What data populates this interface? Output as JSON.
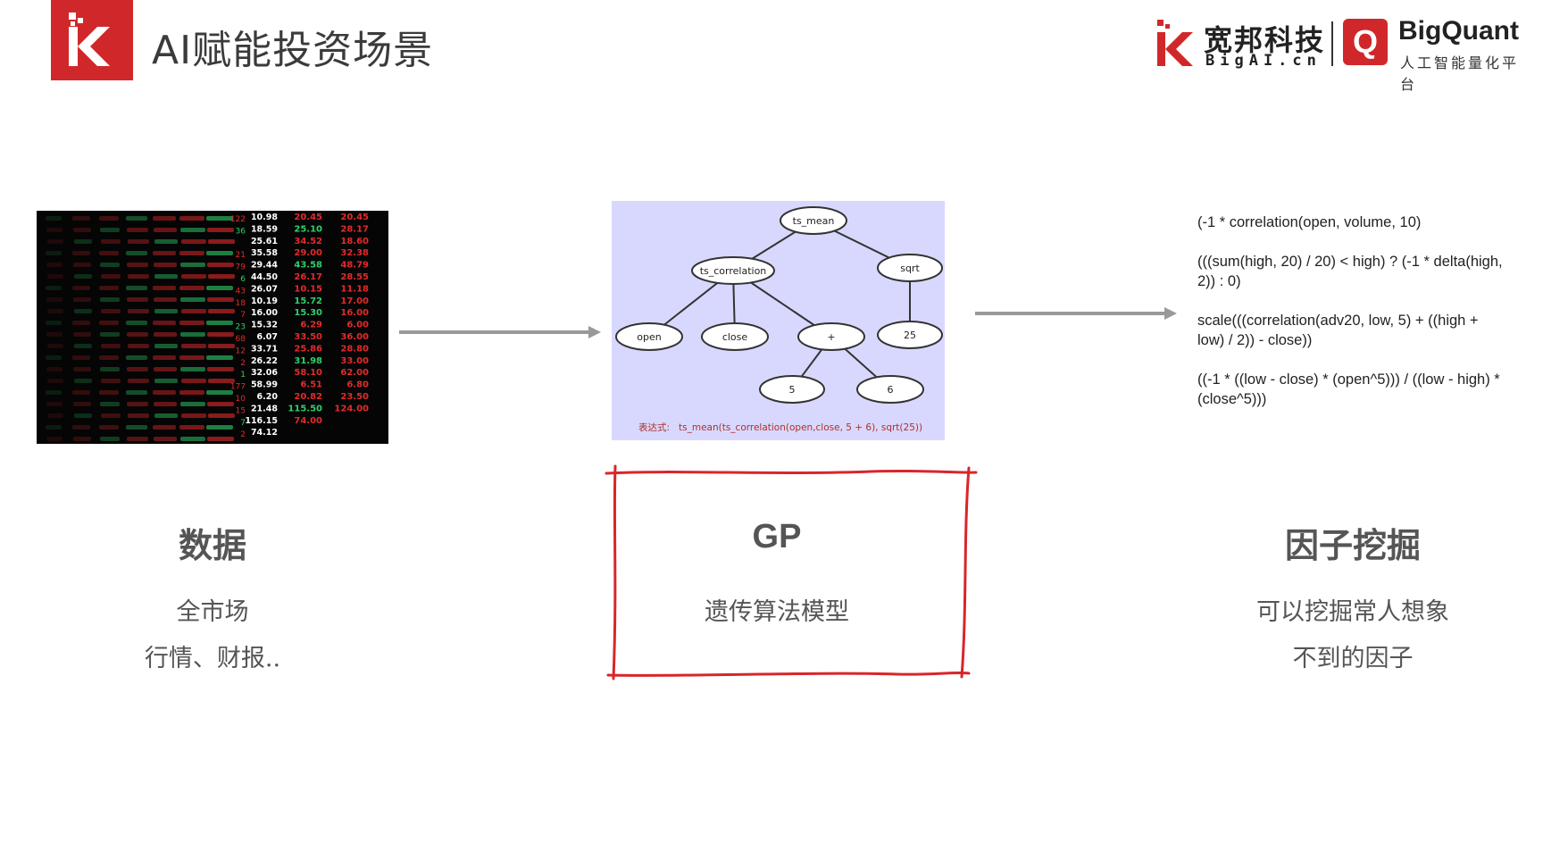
{
  "header": {
    "title": "AI赋能投资场景",
    "logo_letter": "K"
  },
  "partner": {
    "cn_name": "宽邦科技",
    "cn_domain": "BigAI.cn",
    "q_letter": "Q",
    "bq_name": "BigQuant",
    "bq_tagline": "人工智能量化平台"
  },
  "stock_board": {
    "price_columns": [
      [
        "10.98",
        "18.59",
        "25.61",
        "35.58",
        "29.44",
        "44.50",
        "26.07",
        "10.19",
        "16.00",
        "15.32",
        "6.07",
        "33.71",
        "26.22",
        "32.06",
        "58.99",
        "6.20",
        "21.48",
        "116.15",
        "74.12"
      ],
      [
        "20.45",
        "25.10",
        "34.52",
        "29.00",
        "43.58",
        "26.17",
        "10.15",
        "15.72",
        "15.30",
        "6.29",
        "33.50",
        "25.86",
        "31.98",
        "58.10",
        "6.51",
        "20.82",
        "115.50",
        "74.00"
      ],
      [
        "20.45",
        "28.17",
        "18.60",
        "32.38",
        "48.79",
        "28.55",
        "11.18",
        "17.00",
        "16.00",
        "6.00",
        "36.00",
        "28.80",
        "33.00",
        "62.00",
        "6.80",
        "23.50",
        "124.00"
      ]
    ],
    "change_column": [
      "122",
      "36",
      "",
      "21",
      "79",
      "6",
      "43",
      "18",
      "7",
      "23",
      "68",
      "12",
      "2",
      "1",
      "177",
      "10",
      "15",
      "7",
      "2"
    ]
  },
  "tree": {
    "nodes": {
      "root": "ts_mean",
      "corr": "ts_correlation",
      "sqrt": "sqrt",
      "open": "open",
      "close": "close",
      "plus": "+",
      "n25": "25",
      "n5": "5",
      "n6": "6"
    },
    "caption_label": "表达式:",
    "caption_expr": "ts_mean(ts_correlation(open,close, 5 + 6), sqrt(25))"
  },
  "formulas": [
    "(-1 * correlation(open, volume, 10)",
    "(((sum(high, 20) / 20) < high) ? (-1 * delta(high, 2)) : 0)",
    "scale(((correlation(adv20, low, 5) + ((high + low) / 2)) - close))",
    "((-1 * ((low - close) * (open^5))) / ((low - high) * (close^5)))"
  ],
  "columns": {
    "data": {
      "title": "数据",
      "line1": "全市场",
      "line2": "行情、财报.."
    },
    "gp": {
      "title": "GP",
      "line1": "遗传算法模型"
    },
    "factor": {
      "title": "因子挖掘",
      "line1": "可以挖掘常人想象",
      "line2": "不到的因子"
    }
  },
  "colors": {
    "brand_red": "#d0282a",
    "tree_bg": "#d8d8ff",
    "arrow": "#999999",
    "stock_up": "#e22b2b",
    "stock_down": "#2fd06a"
  }
}
